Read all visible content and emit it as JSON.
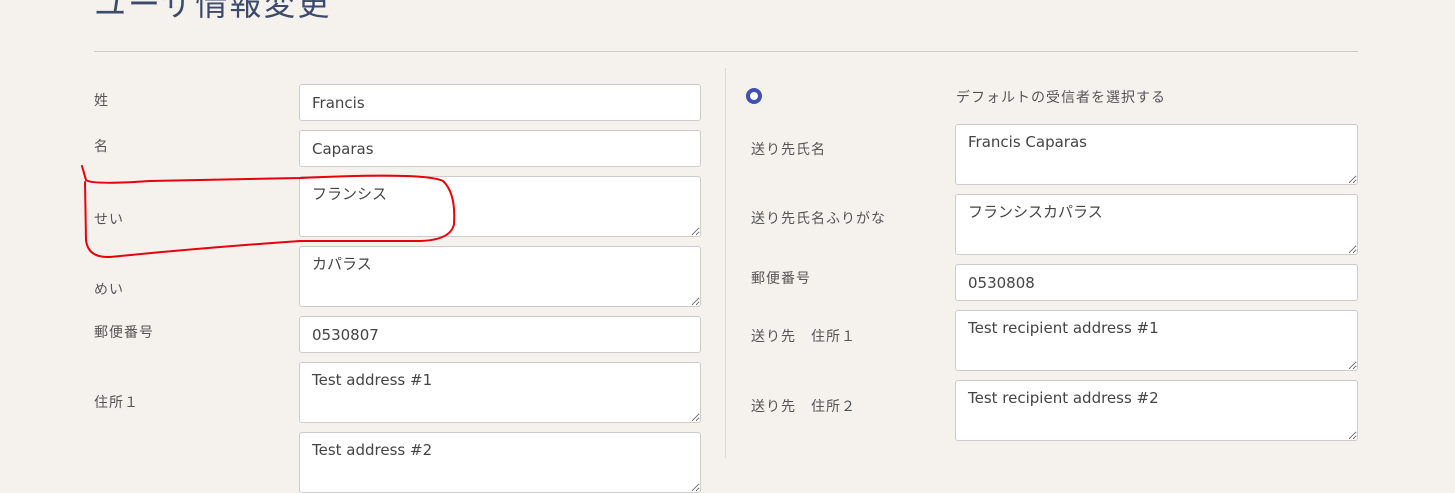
{
  "page": {
    "title": "ユーザ情報変更"
  },
  "user": {
    "last_name": {
      "label": "姓",
      "value": "Francis"
    },
    "first_name": {
      "label": "名",
      "value": "Caparas"
    },
    "last_name_kana": {
      "label": "せい",
      "value": "フランシス"
    },
    "first_name_kana": {
      "label": "めい",
      "value": "カパラス"
    },
    "postal_code": {
      "label": "郵便番号",
      "value": "0530807"
    },
    "address1": {
      "label": "住所１",
      "value": "Test address #1"
    },
    "address2": {
      "value": "Test address #2"
    }
  },
  "recipient": {
    "default_option": {
      "label": "デフォルトの受信者を選択する",
      "selected": true
    },
    "name": {
      "label": "送り先氏名",
      "value": "Francis Caparas"
    },
    "name_kana": {
      "label": "送り先氏名ふりがな",
      "value": "フランシスカパラス"
    },
    "postal_code": {
      "label": "郵便番号",
      "value": "0530808"
    },
    "address1": {
      "label": "送り先　住所１",
      "value": "Test recipient address #1"
    },
    "address2": {
      "label": "送り先　住所２",
      "value": "Test recipient address #2"
    }
  },
  "colors": {
    "accent": "#3f51b5",
    "annotation": "#e8000b",
    "background": "#f5f2ee"
  }
}
